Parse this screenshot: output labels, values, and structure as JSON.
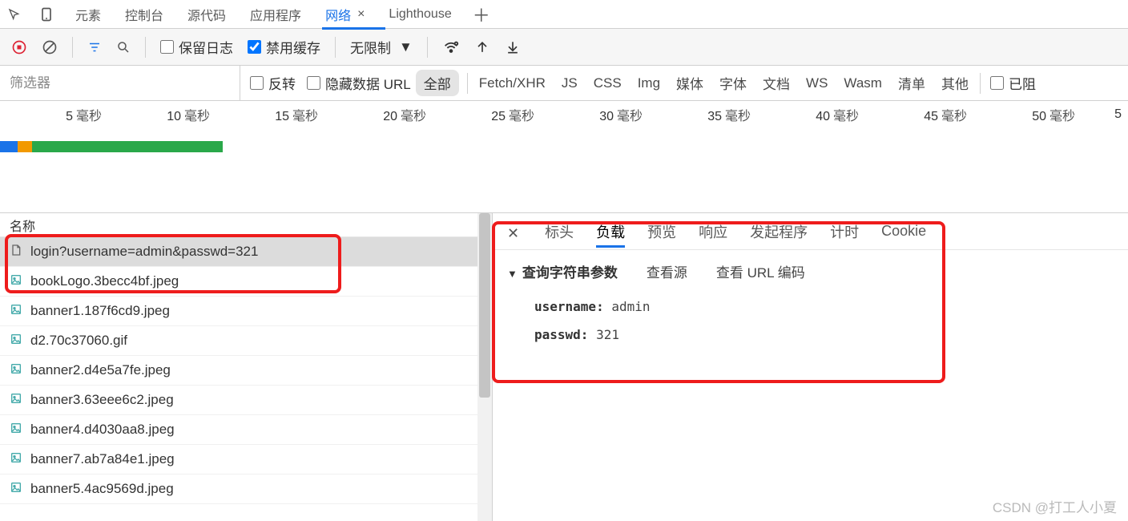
{
  "mainTabs": {
    "items": [
      "元素",
      "控制台",
      "源代码",
      "应用程序",
      "网络",
      "Lighthouse"
    ],
    "activeIndex": 4
  },
  "toolbar": {
    "preserveLog": "保留日志",
    "disableCache": "禁用缓存",
    "throttle": "无限制"
  },
  "filterRow": {
    "placeholder": "筛选器",
    "invert": "反转",
    "hideDataUrl": "隐藏数据 URL",
    "all": "全部",
    "types": [
      "Fetch/XHR",
      "JS",
      "CSS",
      "Img",
      "媒体",
      "字体",
      "文档",
      "WS",
      "Wasm",
      "清单",
      "其他"
    ],
    "blocked": "已阻"
  },
  "timeline": {
    "ticks": [
      "5",
      "10",
      "15",
      "20",
      "25",
      "30",
      "35",
      "40",
      "45",
      "50"
    ],
    "unit": "毫秒",
    "extra": "5"
  },
  "requests": {
    "header": "名称",
    "items": [
      {
        "name": "login?username=admin&passwd=321",
        "icon": "doc",
        "selected": true
      },
      {
        "name": "bookLogo.3becc4bf.jpeg",
        "icon": "img"
      },
      {
        "name": "banner1.187f6cd9.jpeg",
        "icon": "img"
      },
      {
        "name": "d2.70c37060.gif",
        "icon": "img"
      },
      {
        "name": "banner2.d4e5a7fe.jpeg",
        "icon": "img"
      },
      {
        "name": "banner3.63eee6c2.jpeg",
        "icon": "img"
      },
      {
        "name": "banner4.d4030aa8.jpeg",
        "icon": "img"
      },
      {
        "name": "banner7.ab7a84e1.jpeg",
        "icon": "img"
      },
      {
        "name": "banner5.4ac9569d.jpeg",
        "icon": "img"
      }
    ]
  },
  "detail": {
    "tabs": [
      "标头",
      "负载",
      "预览",
      "响应",
      "发起程序",
      "计时",
      "Cookie"
    ],
    "activeIndex": 1,
    "section": {
      "title": "查询字符串参数",
      "viewSource": "查看源",
      "viewEncoded": "查看 URL 编码"
    },
    "params": [
      {
        "key": "username",
        "value": "admin"
      },
      {
        "key": "passwd",
        "value": "321"
      }
    ]
  },
  "watermark": "CSDN @打工人小夏"
}
